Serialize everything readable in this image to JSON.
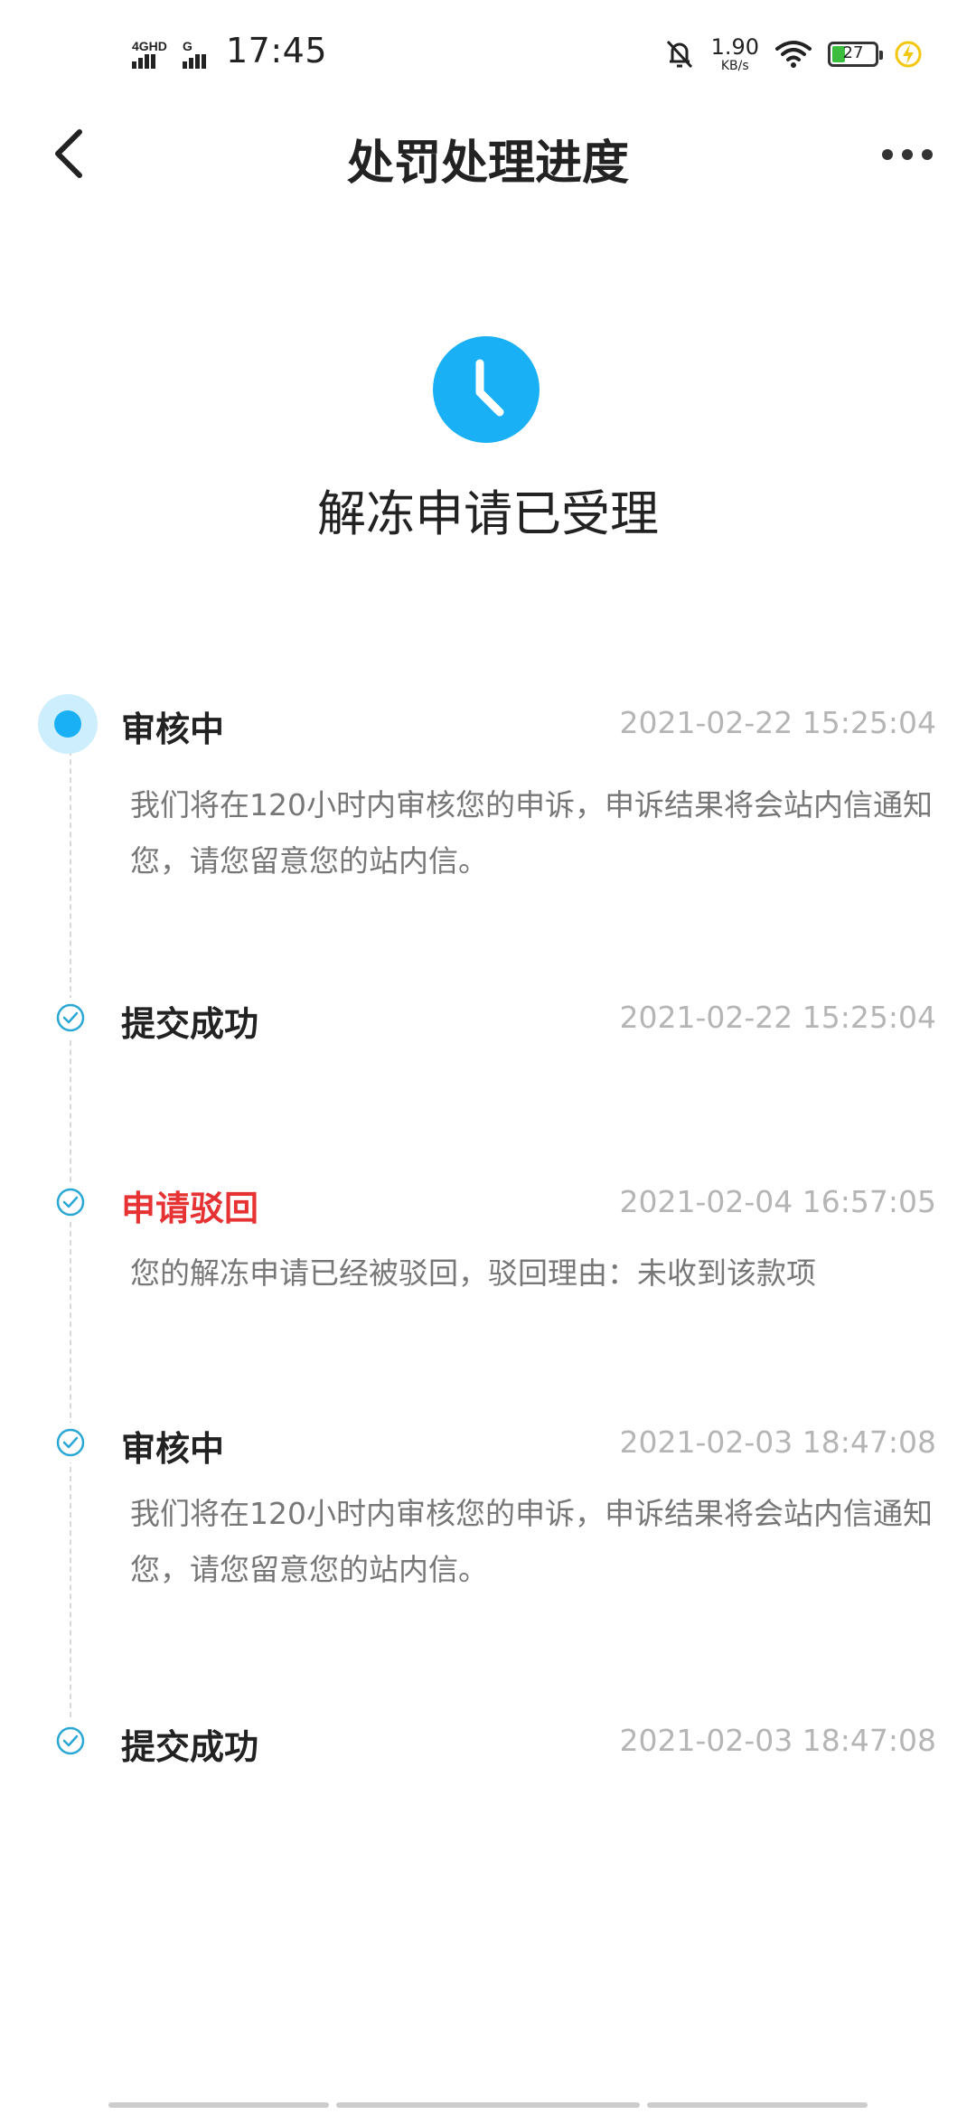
{
  "status_bar": {
    "time": "17:45",
    "network_label": "4GHD",
    "network_label2": "G",
    "speed_value": "1.90",
    "speed_unit": "KB/s",
    "battery_level": "27",
    "battery_fraction": 0.27
  },
  "nav": {
    "title": "处罚处理进度"
  },
  "header": {
    "status_title": "解冻申请已受理",
    "icon": "clock-icon",
    "accent_color": "#1ab0f5"
  },
  "timeline": {
    "items": [
      {
        "label": "审核中",
        "time": "2021-02-22 15:25:04",
        "desc": "我们将在120小时内审核您的申诉，申诉结果将会站内信通知您，请您留意您的站内信。",
        "state": "current"
      },
      {
        "label": "提交成功",
        "time": "2021-02-22 15:25:04",
        "desc": "",
        "state": "done"
      },
      {
        "label": "申请驳回",
        "time": "2021-02-04 16:57:05",
        "desc": "您的解冻申请已经被驳回，驳回理由：未收到该款项",
        "state": "rejected"
      },
      {
        "label": "审核中",
        "time": "2021-02-03 18:47:08",
        "desc": "我们将在120小时内审核您的申诉，申诉结果将会站内信通知您，请您留意您的站内信。",
        "state": "done"
      },
      {
        "label": "提交成功",
        "time": "2021-02-03 18:47:08",
        "desc": "",
        "state": "done"
      }
    ]
  },
  "colors": {
    "accent": "#1ab0f5",
    "rejected": "#e63232",
    "check": "#29a8d6"
  }
}
